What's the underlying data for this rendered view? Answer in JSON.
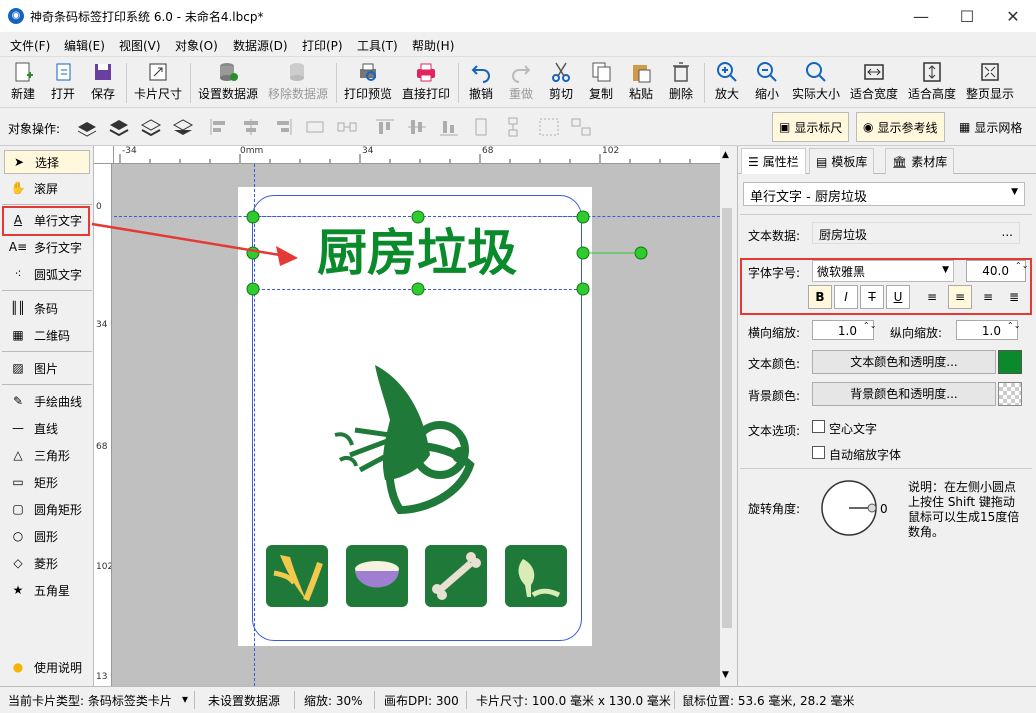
{
  "window": {
    "title": "神奇条码标签打印系统 6.0 - 未命名4.lbcp*"
  },
  "menu": [
    "文件(F)",
    "编辑(E)",
    "视图(V)",
    "对象(O)",
    "数据源(D)",
    "打印(P)",
    "工具(T)",
    "帮助(H)"
  ],
  "toolbar": [
    "新建",
    "打开",
    "保存",
    "卡片尺寸",
    "设置数据源",
    "移除数据源",
    "打印预览",
    "直接打印",
    "撤销",
    "重做",
    "剪切",
    "复制",
    "粘贴",
    "删除",
    "放大",
    "缩小",
    "实际大小",
    "适合宽度",
    "适合高度",
    "整页显示"
  ],
  "objbar": {
    "label": "对象操作:",
    "toggles": [
      "显示标尺",
      "显示参考线",
      "显示网格"
    ]
  },
  "tools": [
    "选择",
    "滚屏",
    "单行文字",
    "多行文字",
    "圆弧文字",
    "条码",
    "二维码",
    "图片",
    "手绘曲线",
    "直线",
    "三角形",
    "矩形",
    "圆角矩形",
    "圆形",
    "菱形",
    "五角星",
    "使用说明"
  ],
  "ruler": {
    "h": [
      "-34",
      "0mm",
      "34",
      "68",
      "102"
    ],
    "v": [
      "0",
      "34",
      "68",
      "102",
      "13"
    ]
  },
  "canvas": {
    "title_text": "厨房垃圾",
    "title_color": "#0a8a2a",
    "icon_bg": "#1f7a3a"
  },
  "panel": {
    "tabs": [
      "属性栏",
      "模板库",
      "素材库"
    ],
    "object_select": "单行文字 - 厨房垃圾",
    "text_data_label": "文本数据:",
    "text_data_value": "厨房垃圾",
    "ellipsis": "...",
    "font_label": "字体字号:",
    "font_name": "微软雅黑",
    "font_size": "40.0",
    "fmt_buttons": [
      "B",
      "I",
      "T",
      "U"
    ],
    "hscale_label": "横向缩放:",
    "hscale": "1.0",
    "vscale_label": "纵向缩放:",
    "vscale": "1.0",
    "text_color_label": "文本颜色:",
    "text_color_btn": "文本颜色和透明度...",
    "text_color": "#0a8a2a",
    "bg_color_label": "背景颜色:",
    "bg_color_btn": "背景颜色和透明度...",
    "text_opts_label": "文本选项:",
    "opt1": "空心文字",
    "opt2": "自动缩放字体",
    "rotate_label": "旋转角度:",
    "rotate_value": "0",
    "note": "说明：在左侧小圆点上按住 Shift 键拖动鼠标可以生成15度倍数角。"
  },
  "status": {
    "card_type": "当前卡片类型: 条码标签类卡片",
    "datasource": "未设置数据源",
    "zoom": "缩放: 30%",
    "dpi": "画布DPI: 300",
    "card_size": "卡片尺寸: 100.0 毫米 x 130.0 毫米",
    "mouse": "鼠标位置: 53.6 毫米, 28.2 毫米"
  }
}
